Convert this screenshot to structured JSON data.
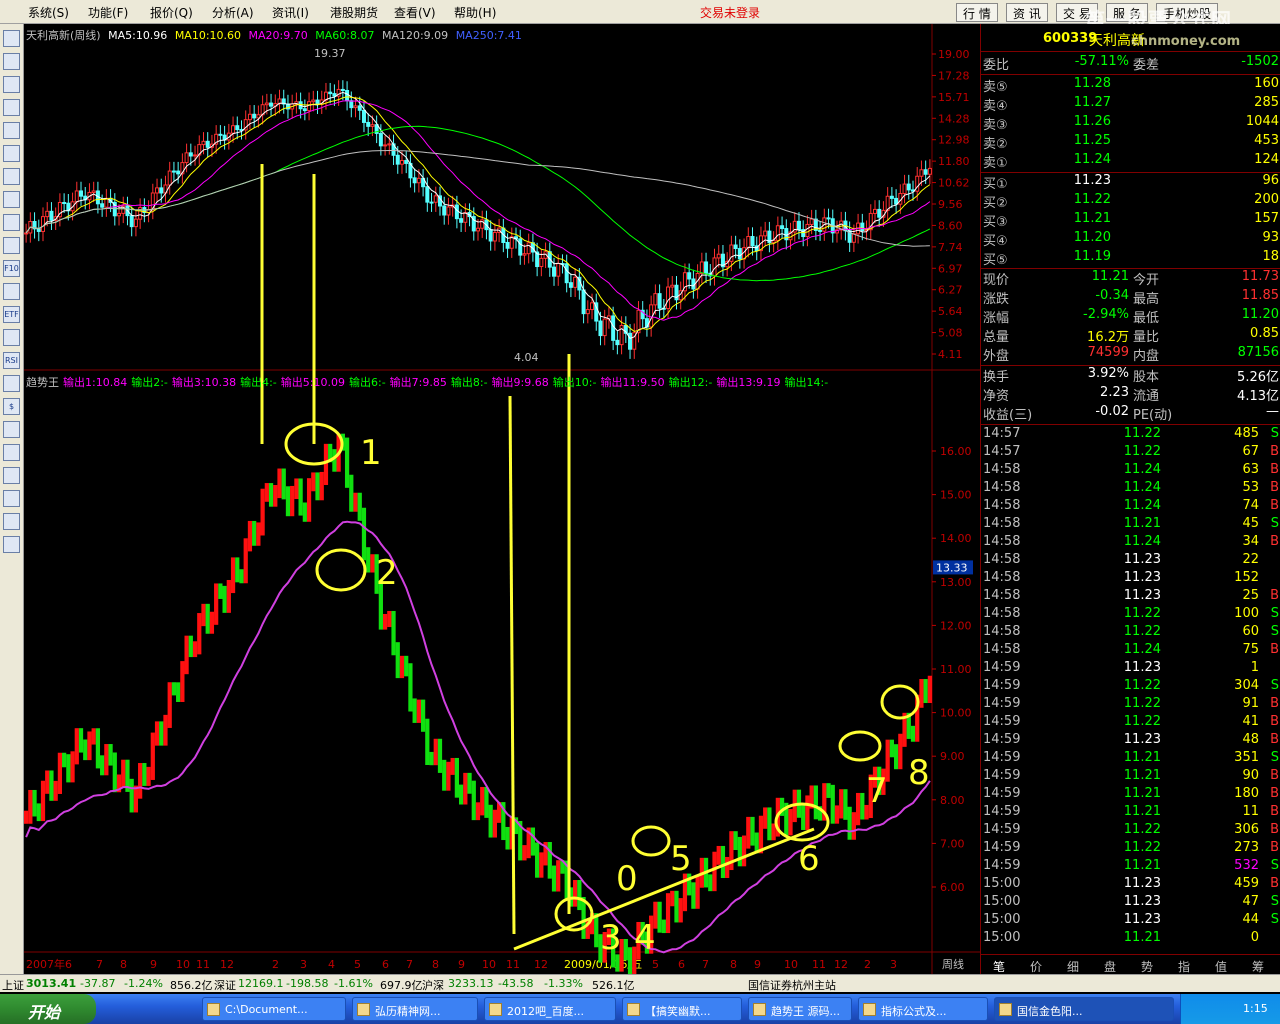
{
  "menubar": {
    "items": [
      "系统(S)",
      "功能(F)",
      "报价(Q)",
      "分析(A)",
      "资讯(I)",
      "港股期货",
      "查看(V)",
      "帮助(H)"
    ],
    "trade_status": "交易未登录",
    "tabs": [
      "行 情",
      "资 讯",
      "交 易",
      "服 务",
      "手机炒股"
    ]
  },
  "watermark": {
    "text": "第一股票公式网",
    "url": "chnmoney.com"
  },
  "toolbar": {
    "icons": [
      "grid-icon",
      "table-icon",
      "chart-icon",
      "kline-icon",
      "bars-icon",
      "window-icon",
      "list-icon",
      "multi-icon",
      "info-icon",
      "people-icon",
      "f10-icon",
      "zoom-icon",
      "etf-icon",
      "line-icon",
      "rsi-icon",
      "refresh-icon",
      "dollar-icon",
      "link-icon",
      "export-icon",
      "pen-icon",
      "move-icon",
      "up-icon",
      "down-icon"
    ],
    "labels": [
      "",
      "",
      "",
      "",
      "",
      "",
      "",
      "",
      "",
      "",
      "F10",
      "",
      "ETF",
      "",
      "RSI",
      "",
      "$",
      "",
      "",
      "",
      "",
      "",
      ""
    ]
  },
  "upper": {
    "stock": "天利高新(周线)",
    "ma5": "MA5:10.96",
    "ma10": "MA10:10.60",
    "ma20": "MA20:9.70",
    "ma60": "MA60:8.07",
    "ma120": "MA120:9.09",
    "ma250": "MA250:7.41",
    "high_label": "19.37",
    "low_label": "4.04",
    "axis": [
      "19.00",
      "17.28",
      "15.71",
      "14.28",
      "12.98",
      "11.80",
      "10.62",
      "9.56",
      "8.60",
      "7.74",
      "6.97",
      "6.27",
      "5.64",
      "5.08",
      "4.11"
    ]
  },
  "lower": {
    "name": "趋势王",
    "outputs": [
      "输出1:10.84",
      "输出2:-",
      "输出3:10.38",
      "输出4:-",
      "输出5:10.09",
      "输出6:-",
      "输出7:9.85",
      "输出8:-",
      "输出9:9.68",
      "输出10:-",
      "输出11:9.50",
      "输出12:-",
      "输出13:9.19",
      "输出14:-"
    ],
    "axis": [
      "16.00",
      "15.00",
      "14.00",
      "13.00",
      "12.00",
      "11.00",
      "10.00",
      "9.00",
      "8.00",
      "7.00",
      "6.00"
    ],
    "cursor_price": "13.33",
    "annotations": [
      "1",
      "2",
      "3",
      "4",
      "0",
      "5",
      "6",
      "7",
      "8"
    ]
  },
  "xaxis": {
    "labels": [
      "2007年6",
      "7",
      "8",
      "9",
      "10",
      "11",
      "12",
      "2",
      "3",
      "4",
      "5",
      "6",
      "7",
      "8",
      "9",
      "10",
      "11",
      "12",
      "2009/01/16/五",
      "5",
      "6",
      "7",
      "8",
      "9",
      "10",
      "11",
      "12",
      "2",
      "3"
    ],
    "period": "周线"
  },
  "quote": {
    "code": "600339",
    "name": "天利高新",
    "weibi_label": "委比",
    "weibi": "-57.11%",
    "weicha_label": "委差",
    "weicha": "-1502",
    "sells": [
      {
        "label": "卖⑤",
        "price": "11.28",
        "vol": "160"
      },
      {
        "label": "卖④",
        "price": "11.27",
        "vol": "285"
      },
      {
        "label": "卖③",
        "price": "11.26",
        "vol": "1044"
      },
      {
        "label": "卖②",
        "price": "11.25",
        "vol": "453"
      },
      {
        "label": "卖①",
        "price": "11.24",
        "vol": "124"
      }
    ],
    "buys": [
      {
        "label": "买①",
        "price": "11.23",
        "vol": "96"
      },
      {
        "label": "买②",
        "price": "11.22",
        "vol": "200"
      },
      {
        "label": "买③",
        "price": "11.21",
        "vol": "157"
      },
      {
        "label": "买④",
        "price": "11.20",
        "vol": "93"
      },
      {
        "label": "买⑤",
        "price": "11.19",
        "vol": "18"
      }
    ],
    "stats": [
      {
        "l1": "现价",
        "v1": "11.21",
        "c1": "#00ff00",
        "l2": "今开",
        "v2": "11.73",
        "c2": "#ff3030"
      },
      {
        "l1": "涨跌",
        "v1": "-0.34",
        "c1": "#00ff00",
        "l2": "最高",
        "v2": "11.85",
        "c2": "#ff3030"
      },
      {
        "l1": "涨幅",
        "v1": "-2.94%",
        "c1": "#00ff00",
        "l2": "最低",
        "v2": "11.20",
        "c2": "#00ff00"
      },
      {
        "l1": "总量",
        "v1": "16.2万",
        "c1": "#ffff00",
        "l2": "量比",
        "v2": "0.85",
        "c2": "#ffff00"
      },
      {
        "l1": "外盘",
        "v1": "74599",
        "c1": "#ff3030",
        "l2": "内盘",
        "v2": "87156",
        "c2": "#00ff00"
      }
    ],
    "fund": [
      {
        "l1": "换手",
        "v1": "3.92%",
        "l2": "股本",
        "v2": "5.26亿"
      },
      {
        "l1": "净资",
        "v1": "2.23",
        "l2": "流通",
        "v2": "4.13亿"
      },
      {
        "l1": "收益(三)",
        "v1": "-0.02",
        "l2": "PE(动)",
        "v2": "—"
      }
    ]
  },
  "ticks": [
    [
      "14:57",
      "11.22",
      "485",
      "S"
    ],
    [
      "14:57",
      "11.22",
      "67",
      "B"
    ],
    [
      "14:58",
      "11.24",
      "63",
      "B"
    ],
    [
      "14:58",
      "11.24",
      "53",
      "B"
    ],
    [
      "14:58",
      "11.24",
      "74",
      "B"
    ],
    [
      "14:58",
      "11.21",
      "45",
      "S"
    ],
    [
      "14:58",
      "11.24",
      "34",
      "B"
    ],
    [
      "14:58",
      "11.23",
      "22",
      ""
    ],
    [
      "14:58",
      "11.23",
      "152",
      ""
    ],
    [
      "14:58",
      "11.23",
      "25",
      "B"
    ],
    [
      "14:58",
      "11.22",
      "100",
      "S"
    ],
    [
      "14:58",
      "11.22",
      "60",
      "S"
    ],
    [
      "14:58",
      "11.24",
      "75",
      "B"
    ],
    [
      "14:59",
      "11.23",
      "1",
      ""
    ],
    [
      "14:59",
      "11.22",
      "304",
      "S"
    ],
    [
      "14:59",
      "11.22",
      "91",
      "B"
    ],
    [
      "14:59",
      "11.22",
      "41",
      "B"
    ],
    [
      "14:59",
      "11.23",
      "48",
      "B"
    ],
    [
      "14:59",
      "11.21",
      "351",
      "S"
    ],
    [
      "14:59",
      "11.21",
      "90",
      "B"
    ],
    [
      "14:59",
      "11.21",
      "180",
      "B"
    ],
    [
      "14:59",
      "11.21",
      "11",
      "B"
    ],
    [
      "14:59",
      "11.22",
      "306",
      "B"
    ],
    [
      "14:59",
      "11.22",
      "273",
      "B"
    ],
    [
      "14:59",
      "11.21",
      "532",
      "S"
    ],
    [
      "15:00",
      "11.23",
      "459",
      "B"
    ],
    [
      "15:00",
      "11.23",
      "47",
      "S"
    ],
    [
      "15:00",
      "11.23",
      "44",
      "S"
    ],
    [
      "15:00",
      "11.21",
      "0",
      ""
    ]
  ],
  "right_tabs": [
    "笔",
    "价",
    "细",
    "盘",
    "势",
    "指",
    "值",
    "筹"
  ],
  "index_bar": {
    "sh_label": "上证",
    "sh": "3013.41",
    "sh_chg": "-37.87",
    "sh_pct": "-1.24%",
    "sh_amt": "856.2亿",
    "sz_label": "深证",
    "sz": "12169.1",
    "sz_chg": "-198.58",
    "sz_pct": "-1.61%",
    "sz_amt": "697.9亿",
    "hs_label": "沪深",
    "hs": "3233.13",
    "hs_chg": "-43.58",
    "hs_pct": "-1.33%",
    "hs_amt": "526.1亿",
    "station": "国信证券杭州主站"
  },
  "taskbar": {
    "start": "开始",
    "tasks": [
      "C:\\Document...",
      "弘历精神网...",
      "2012吧_百度...",
      "【搞笑幽默...",
      "趋势王 源码...",
      "指标公式及...",
      "国信金色阳..."
    ],
    "clock": "1:15"
  }
}
